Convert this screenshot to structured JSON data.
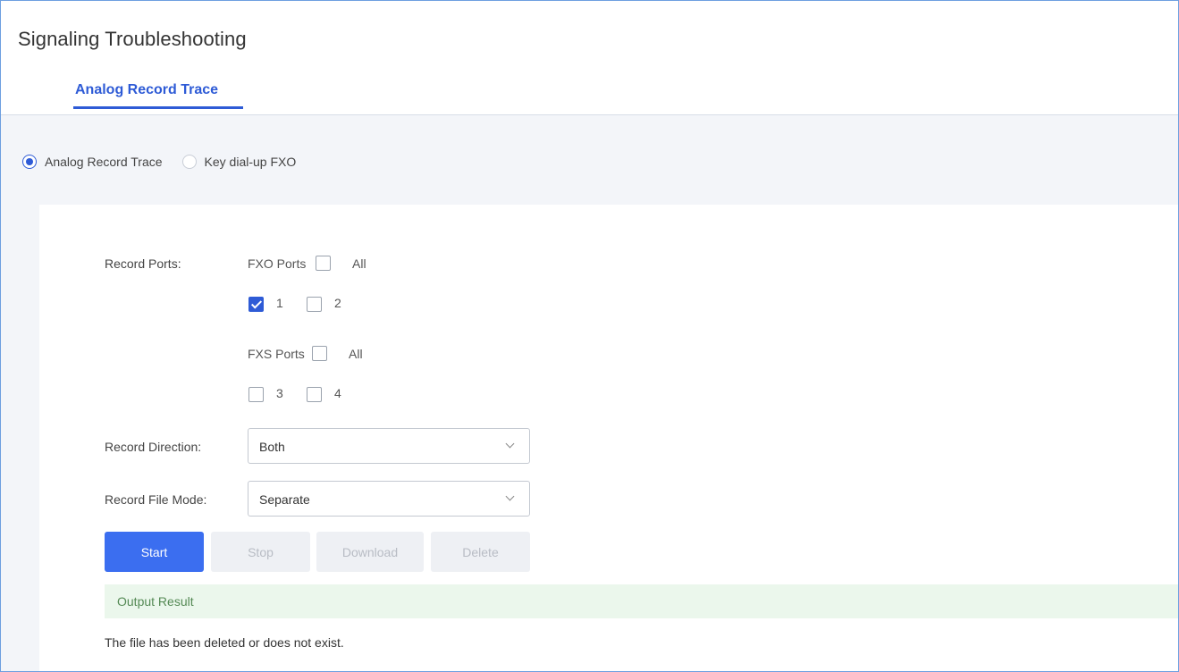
{
  "page": {
    "title": "Signaling Troubleshooting"
  },
  "tabs": [
    {
      "label": "Analog Record Trace",
      "active": true
    }
  ],
  "mode": {
    "options": [
      {
        "label": "Analog Record Trace",
        "selected": true
      },
      {
        "label": "Key dial-up FXO",
        "selected": false
      }
    ]
  },
  "form": {
    "record_ports_label": "Record Ports:",
    "fxo": {
      "label": "FXO Ports",
      "all_label": "All",
      "all_checked": false,
      "ports": [
        {
          "label": "1",
          "checked": true
        },
        {
          "label": "2",
          "checked": false
        }
      ]
    },
    "fxs": {
      "label": "FXS Ports",
      "all_label": "All",
      "all_checked": false,
      "ports": [
        {
          "label": "3",
          "checked": false
        },
        {
          "label": "4",
          "checked": false
        }
      ]
    },
    "record_direction": {
      "label": "Record Direction:",
      "value": "Both"
    },
    "record_file_mode": {
      "label": "Record File Mode:",
      "value": "Separate"
    }
  },
  "buttons": {
    "start": {
      "label": "Start",
      "enabled": true
    },
    "stop": {
      "label": "Stop",
      "enabled": false
    },
    "download": {
      "label": "Download",
      "enabled": false
    },
    "delete": {
      "label": "Delete",
      "enabled": false
    }
  },
  "output": {
    "title": "Output Result",
    "message": "The file has been deleted or does not exist."
  },
  "colors": {
    "accent": "#2e5bd6",
    "primary_button": "#3b6ef0",
    "result_bar": "#ebf7ec"
  }
}
